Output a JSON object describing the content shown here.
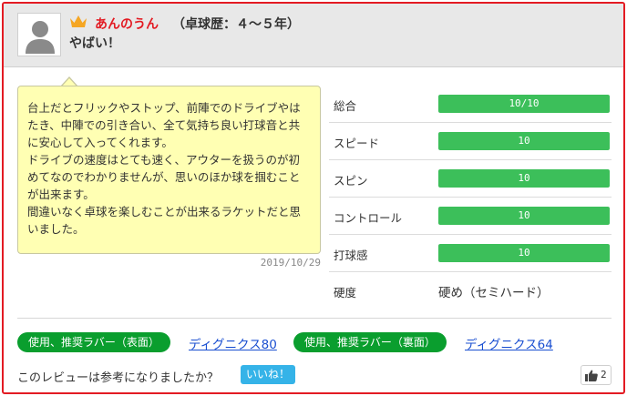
{
  "header": {
    "username": "あんのうん",
    "career": "（卓球歴：４～５年）",
    "title": "やばい！"
  },
  "review": {
    "comment": "台上だとフリックやストップ、前陣でのドライブやはたき、中陣での引き合い、全て気持ち良い打球音と共に安心して入ってくれます。\nドライブの速度はとても速く、アウターを扱うのが初めてなのでわかりませんが、思いのほか球を掴むことが出来ます。\n間違いなく卓球を楽しむことが出来るラケットだと思いました。",
    "date": "2019/10/29"
  },
  "ratings": [
    {
      "label": "総合",
      "value_text": "10/10",
      "fraction": 1.0
    },
    {
      "label": "スピード",
      "value_text": "10",
      "fraction": 1.0
    },
    {
      "label": "スピン",
      "value_text": "10",
      "fraction": 1.0
    },
    {
      "label": "コントロール",
      "value_text": "10",
      "fraction": 1.0
    },
    {
      "label": "打球感",
      "value_text": "10",
      "fraction": 1.0
    }
  ],
  "hardness": {
    "label": "硬度",
    "value": "硬め（セミハード）"
  },
  "rubbers": {
    "front_label": "使用、推奨ラバー（表面）",
    "front_name": "ディグニクス80",
    "back_label": "使用、推奨ラバー（裏面）",
    "back_name": "ディグニクス64"
  },
  "helpful": {
    "question": "このレビューは参考になりましたか？",
    "button_label": "いいね！",
    "count": "2"
  },
  "colors": {
    "border": "#e31b23",
    "username": "#e31b23",
    "rating_fill": "#3cbf5a",
    "badge": "#0a9e2e",
    "link": "#1a4fd1",
    "like_button": "#35b3e8",
    "bubble": "#ffffb3"
  },
  "icons": [
    "user-avatar-icon",
    "crown-icon",
    "thumbs-up-icon"
  ]
}
